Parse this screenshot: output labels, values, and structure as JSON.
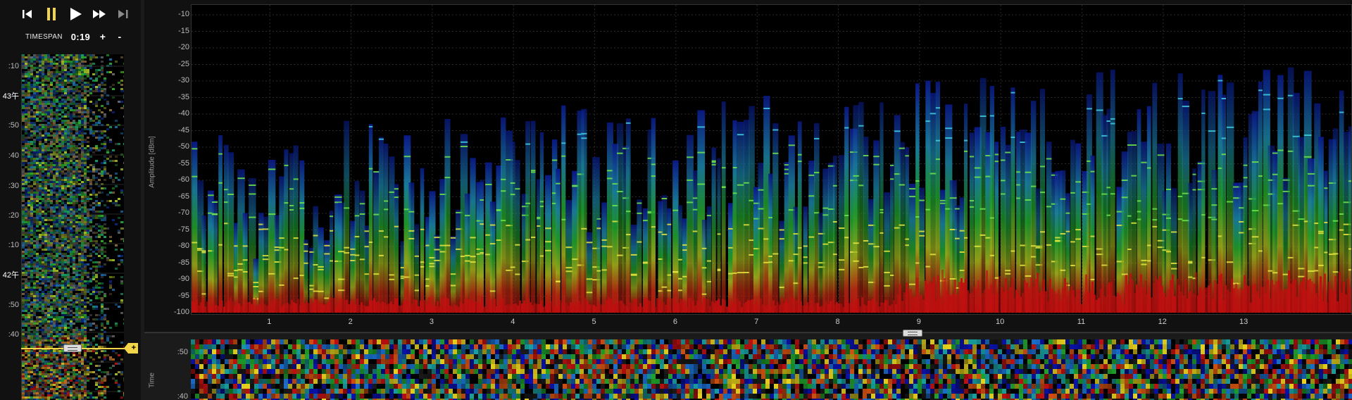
{
  "transport": {
    "buttons": [
      {
        "name": "skip-to-start-icon",
        "color": "#ffffff"
      },
      {
        "name": "pause-icon",
        "color": "#f3d54a"
      },
      {
        "name": "play-icon",
        "color": "#ffffff"
      },
      {
        "name": "fast-forward-icon",
        "color": "#ffffff"
      },
      {
        "name": "step-forward-icon",
        "color": "#8a8a8a"
      }
    ]
  },
  "timespan": {
    "label": "TIMESPAN",
    "value": "0:19",
    "plus": "+",
    "minus": "-"
  },
  "left_waterfall": {
    "ticks": [
      ":10",
      "43午",
      ":50",
      ":40",
      ":30",
      ":20",
      ":10",
      "42午",
      ":50",
      ":40"
    ],
    "cursor_tag": "+"
  },
  "spectrum": {
    "y_axis_label": "Amplitude [dBm]",
    "y_ticks": [
      "-10",
      "-15",
      "-20",
      "-25",
      "-30",
      "-35",
      "-40",
      "-45",
      "-50",
      "-55",
      "-60",
      "-65",
      "-70",
      "-75",
      "-80",
      "-85",
      "-90",
      "-95",
      "-100"
    ],
    "x_ticks": [
      "1",
      "2",
      "3",
      "4",
      "5",
      "6",
      "7",
      "8",
      "9",
      "10",
      "11",
      "12",
      "13"
    ]
  },
  "bottom_waterfall": {
    "y_axis_label": "Time",
    "ticks": [
      ":50",
      ":40"
    ]
  },
  "chart_data": {
    "type": "bar",
    "ylabel": "Amplitude [dBm]",
    "ylim": [
      -100,
      -10
    ],
    "xlim": [
      0,
      14.3
    ],
    "x_ticks": [
      1,
      2,
      3,
      4,
      5,
      6,
      7,
      8,
      9,
      10,
      11,
      12,
      13
    ],
    "grid": true,
    "note_colors": [
      "#0a1a8c",
      "#1a7fa0",
      "#1fa32a",
      "#c8d21a",
      "#c01010"
    ]
  },
  "colors": {
    "accent": "#f3d54a",
    "plot_bg": "#000000",
    "grid": "#2a2a2a"
  }
}
